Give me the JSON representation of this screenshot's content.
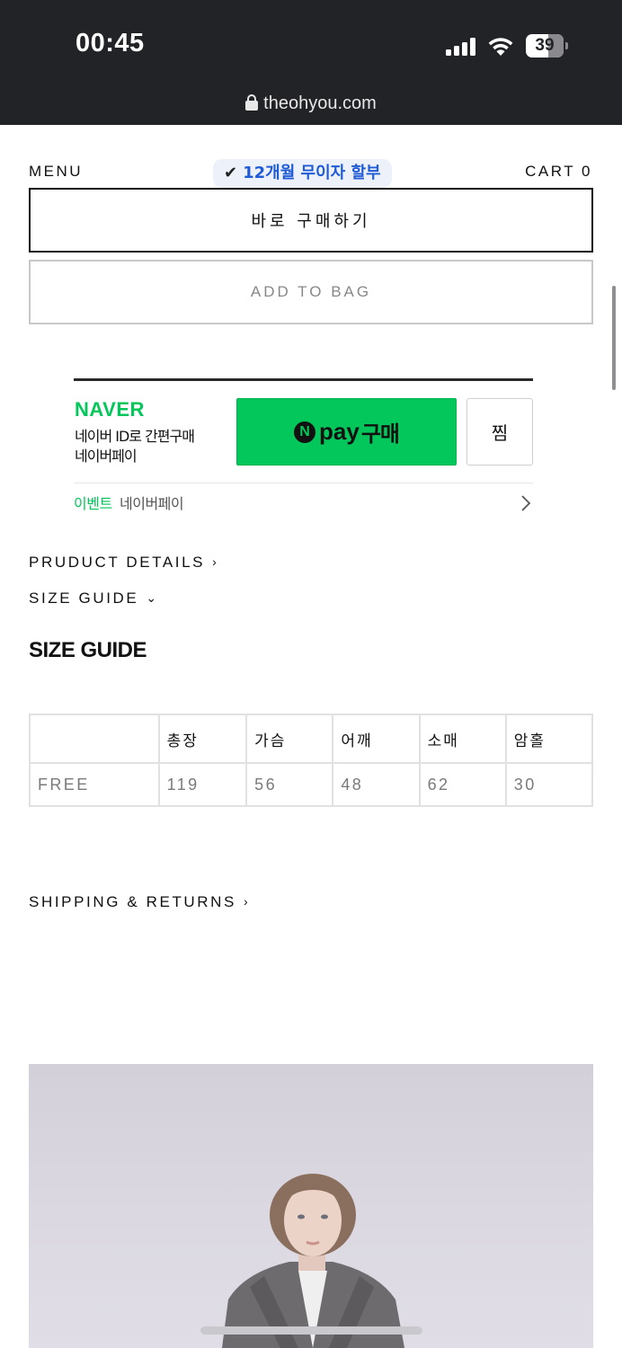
{
  "status_bar": {
    "time": "00:45",
    "battery": "39",
    "url": "theohyou.com"
  },
  "nav": {
    "menu_label": "MENU",
    "cart_label": "CART 0",
    "promo_label": "12개월 무이자 할부"
  },
  "actions": {
    "buy_now": "바로 구매하기",
    "add_to_bag": "ADD TO BAG"
  },
  "naver_pay": {
    "brand": "NAVER",
    "desc_line1": "네이버 ID로 간편구매",
    "desc_line2": "네이버페이",
    "pay_n": "N",
    "pay_label": "pay",
    "pay_label_kr": "구매",
    "wish_label": "찜",
    "event_tag": "이벤트",
    "event_text": "네이버페이",
    "colors": {
      "green": "#03c75a"
    }
  },
  "sections": {
    "product_details": "PRUDUCT DETAILS",
    "size_guide": "SIZE GUIDE",
    "size_guide_title": "SIZE GUIDE",
    "shipping_returns": "SHIPPING & RETURNS"
  },
  "size_table": {
    "headers": [
      "",
      "총장",
      "가슴",
      "어깨",
      "소매",
      "암홀"
    ],
    "rows": [
      [
        "FREE",
        "119",
        "56",
        "48",
        "62",
        "30"
      ]
    ]
  },
  "icons": {
    "lock": "lock-icon",
    "chevron_right": "chevron-right-icon",
    "chevron_down": "chevron-down-icon",
    "check": "check-icon"
  }
}
